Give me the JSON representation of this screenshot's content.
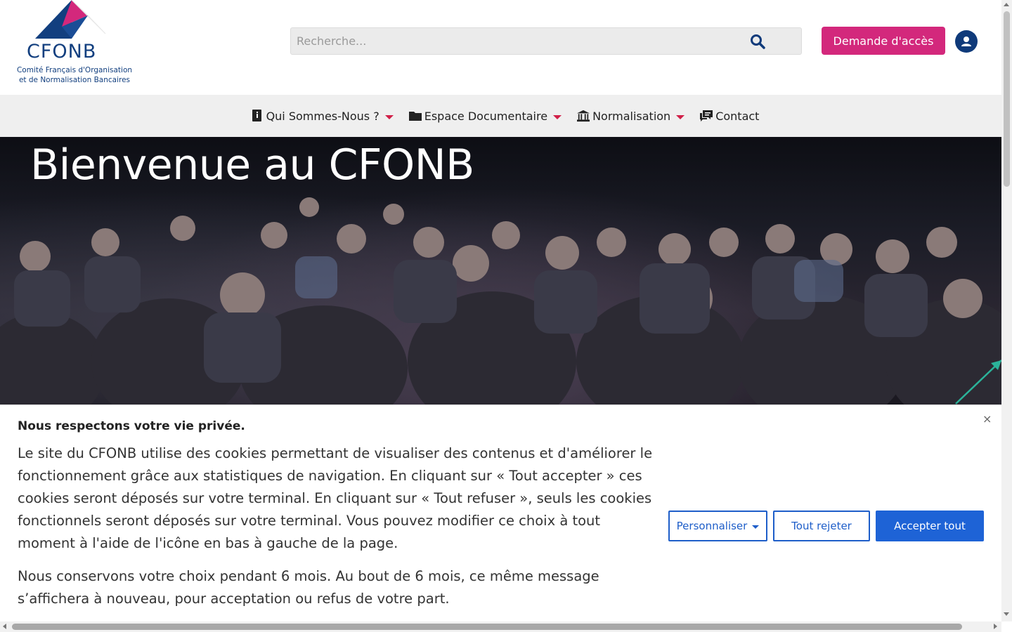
{
  "logo": {
    "word": "CFONB",
    "subtitle_line1": "Comité Français d'Organisation",
    "subtitle_line2": "et de Normalisation Bancaires"
  },
  "search": {
    "placeholder": "Recherche...",
    "icon": "search-icon"
  },
  "header": {
    "access_label": "Demande d'accès",
    "user_icon": "user-circle-icon"
  },
  "nav": {
    "items": [
      {
        "label": "Qui Sommes-Nous ?",
        "icon": "book-info-icon",
        "has_dropdown": true
      },
      {
        "label": "Espace Documentaire",
        "icon": "folder-icon",
        "has_dropdown": true
      },
      {
        "label": "Normalisation",
        "icon": "bank-icon",
        "has_dropdown": true
      },
      {
        "label": "Contact",
        "icon": "chat-icon",
        "has_dropdown": false
      }
    ]
  },
  "hero": {
    "title": "Bienvenue au CFONB"
  },
  "cookie": {
    "title": "Nous respectons votre vie privée.",
    "text": "Le site du CFONB utilise des cookies permettant de visualiser des contenus et d'améliorer le fonctionnement grâce aux statistiques de navigation. En cliquant sur « Tout accepter » ces cookies seront déposés sur votre terminal. En cliquant sur « Tout refuser », seuls les cookies fonctionnels seront déposés sur votre terminal. Vous pouvez modifier ce choix à tout moment à l'aide de l'icône en bas à gauche de la page.",
    "text2": "Nous conservons votre choix pendant 6 mois. Au bout de 6 mois, ce même message s’affichera à nouveau, pour acceptation ou refus de votre part.",
    "customize_label": "Personnaliser",
    "reject_label": "Tout rejeter",
    "accept_label": "Accepter tout",
    "close_label": "×"
  },
  "colors": {
    "brand_navy": "#123f7f",
    "brand_pink": "#d3287c",
    "accent_red": "#d11f48",
    "button_blue": "#1e63d6"
  }
}
